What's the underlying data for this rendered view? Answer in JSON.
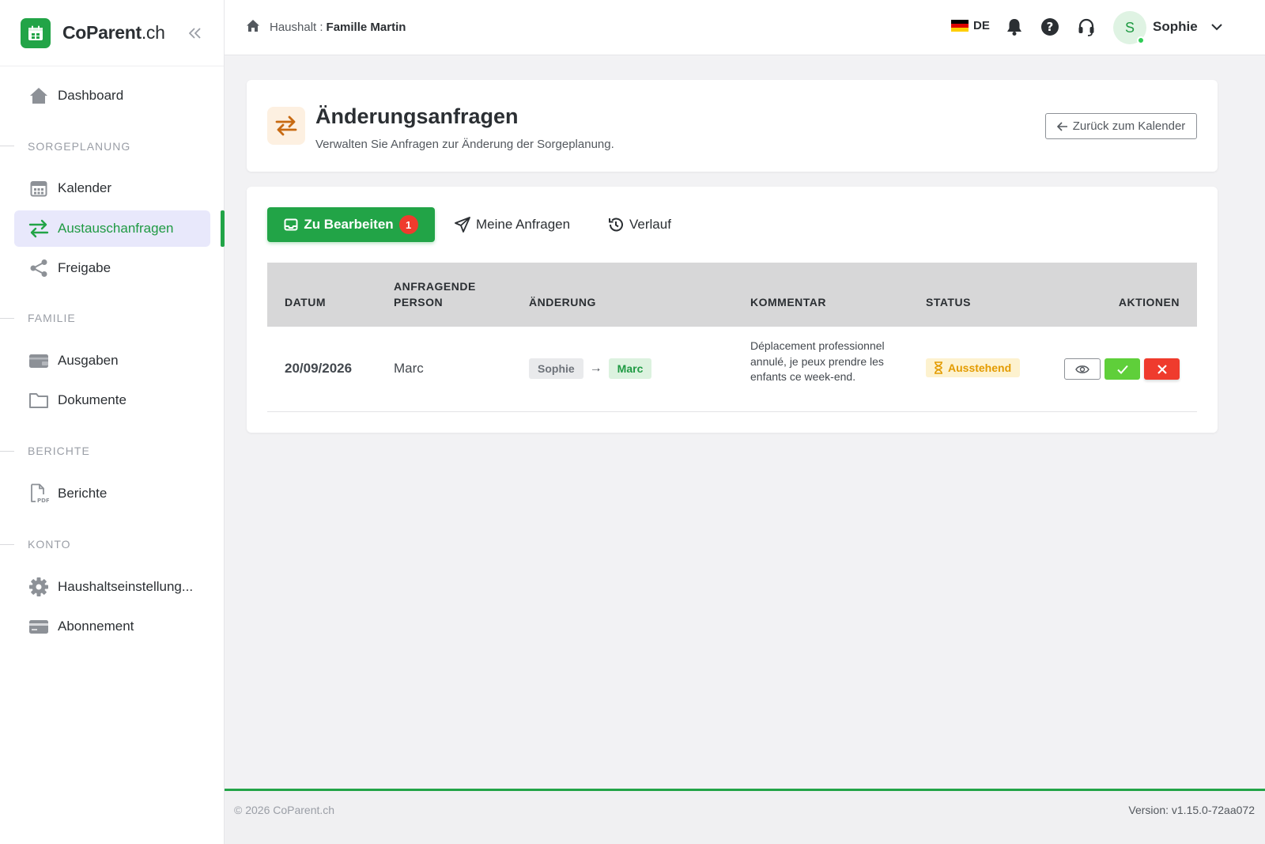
{
  "brand": {
    "name": "CoParent",
    "tld": ".ch"
  },
  "sidebar": {
    "items": [
      {
        "label": "Dashboard",
        "icon": "home-icon"
      },
      {
        "label": "Kalender",
        "icon": "calendar-icon"
      },
      {
        "label": "Austauschanfragen",
        "icon": "swap-icon",
        "active": true
      },
      {
        "label": "Freigabe",
        "icon": "share-icon"
      },
      {
        "label": "Ausgaben",
        "icon": "wallet-icon"
      },
      {
        "label": "Dokumente",
        "icon": "folder-icon"
      },
      {
        "label": "Berichte",
        "icon": "pdf-icon"
      },
      {
        "label": "Haushaltseinstellung...",
        "icon": "gear-icon"
      },
      {
        "label": "Abonnement",
        "icon": "credit-card-icon"
      }
    ],
    "sections": [
      "SORGEPLANUNG",
      "FAMILIE",
      "BERICHTE",
      "KONTO"
    ]
  },
  "header": {
    "breadcrumb_prefix": "Haushalt :",
    "household": "Famille Martin",
    "language": "DE",
    "user_initial": "S",
    "user_name": "Sophie"
  },
  "page": {
    "title": "Änderungsanfragen",
    "subtitle": "Verwalten Sie Anfragen zur Änderung der Sorgeplanung.",
    "back_label": "Zurück zum Kalender"
  },
  "tabs": [
    {
      "label": "Zu Bearbeiten",
      "badge": "1",
      "active": true
    },
    {
      "label": "Meine Anfragen"
    },
    {
      "label": "Verlauf"
    }
  ],
  "table": {
    "headers": [
      "DATUM",
      "ANFRAGENDE PERSON",
      "ÄNDERUNG",
      "KOMMENTAR",
      "STATUS",
      "AKTIONEN"
    ],
    "header_lines": {
      "person_1": "ANFRAGENDE",
      "person_2": "PERSON"
    },
    "rows": [
      {
        "date": "20/09/2026",
        "person": "Marc",
        "from": "Sophie",
        "to": "Marc",
        "comment": "Déplacement professionnel annulé, je peux prendre les enfants ce week-end.",
        "status": "Ausstehend"
      }
    ]
  },
  "footer": {
    "copyright": "© 2026 CoParent.ch",
    "version": "Version: v1.15.0-72aa072"
  },
  "colors": {
    "brand_green": "#22a447",
    "active_bg": "#e8e8fb",
    "danger": "#ef3b2d",
    "accept": "#5fcf3a",
    "pending_bg": "#fdf2cf",
    "pending_text": "#e39b00",
    "header_icon_bg": "#fdf0e1"
  }
}
